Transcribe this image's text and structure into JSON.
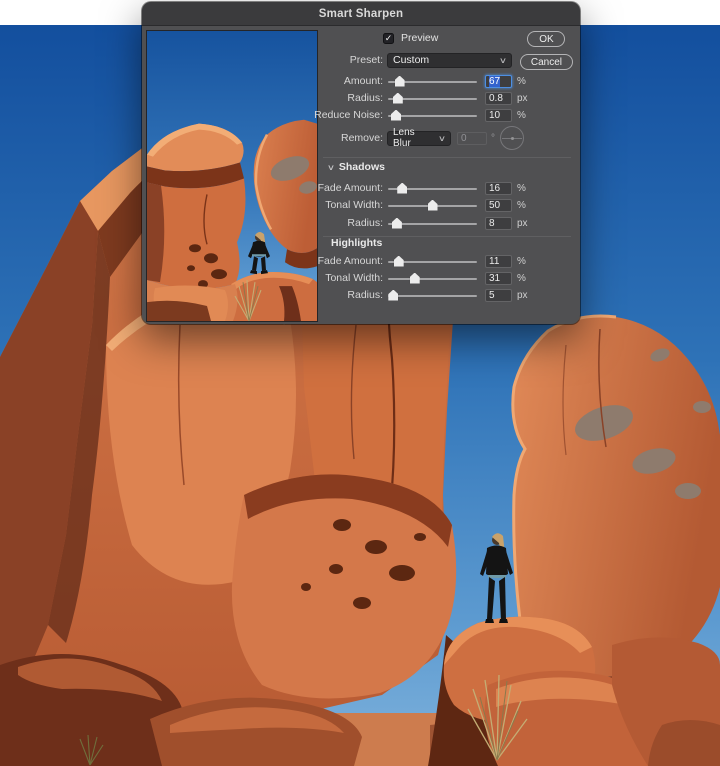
{
  "dialog": {
    "title": "Smart Sharpen",
    "preview_checkbox": {
      "label": "Preview",
      "checked": true
    },
    "preset": {
      "label": "Preset:",
      "value": "Custom"
    },
    "sharpen": {
      "amount": {
        "label": "Amount:",
        "value": "67",
        "unit": "%",
        "selected": true
      },
      "radius": {
        "label": "Radius:",
        "value": "0.8",
        "unit": "px"
      },
      "reduce_noise": {
        "label": "Reduce Noise:",
        "value": "10",
        "unit": "%"
      }
    },
    "remove": {
      "label": "Remove:",
      "value": "Lens Blur",
      "angle_value": "0",
      "angle_unit": "°"
    },
    "shadows": {
      "section_label": "Shadows",
      "fade_amount": {
        "label": "Fade Amount:",
        "value": "16",
        "unit": "%"
      },
      "tonal_width": {
        "label": "Tonal Width:",
        "value": "50",
        "unit": "%"
      },
      "radius": {
        "label": "Radius:",
        "value": "8",
        "unit": "px"
      }
    },
    "highlights": {
      "section_label": "Highlights",
      "fade_amount": {
        "label": "Fade Amount:",
        "value": "11",
        "unit": "%"
      },
      "tonal_width": {
        "label": "Tonal Width:",
        "value": "31",
        "unit": "%"
      },
      "radius": {
        "label": "Radius:",
        "value": "5",
        "unit": "px"
      }
    },
    "buttons": {
      "ok": "OK",
      "cancel": "Cancel"
    }
  },
  "icons": {
    "check": "✓",
    "chevron_down": "∨"
  },
  "colors": {
    "selection_blue": "#3463cd",
    "focus_ring": "#4d8fe3",
    "dialog_bg": "#505052",
    "titlebar_bg": "#3b3b3d",
    "sky_blue": "#2e72b7",
    "rock_orange": "#c96a40"
  }
}
